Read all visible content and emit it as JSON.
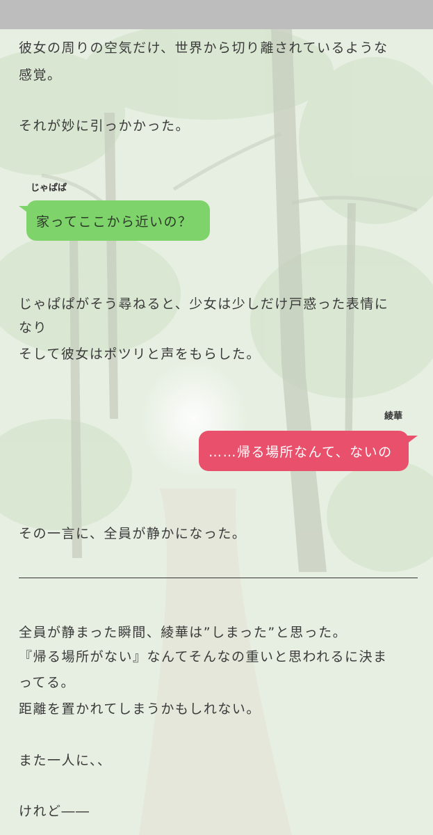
{
  "story": {
    "top_partial": "",
    "para1_line1": "彼女の周りの空気だけ、世界から切り離されているような",
    "para1_line2": "感覚。",
    "para2": "それが妙に引っかかった。",
    "msg1": {
      "speaker": "じゃぱぱ",
      "text": "家ってここから近いの？"
    },
    "para3_line1": "じゃぱぱがそう尋ねると、少女は少しだけ戸惑った表情に",
    "para3_line2": "なり",
    "para3_line3": "そして彼女はポツリと声をもらした。",
    "msg2": {
      "speaker": "綾華",
      "text": "……帰る場所なんて、ないの"
    },
    "para4": "その一言に、全員が静かになった。",
    "para5_line1": "全員が静まった瞬間、綾華は”しまった”と思った。",
    "para5_line2": "『帰る場所がない』なんてそんなの重いと思われるに決ま",
    "para5_line3": "ってる。",
    "para5_line4": "距離を置かれてしまうかもしれない。",
    "para6": "また一人に、、",
    "para7": "けれど――"
  },
  "colors": {
    "green_bubble": "#7ed46a",
    "red_bubble": "#e9506c",
    "top_bar": "#bdbdbd"
  }
}
